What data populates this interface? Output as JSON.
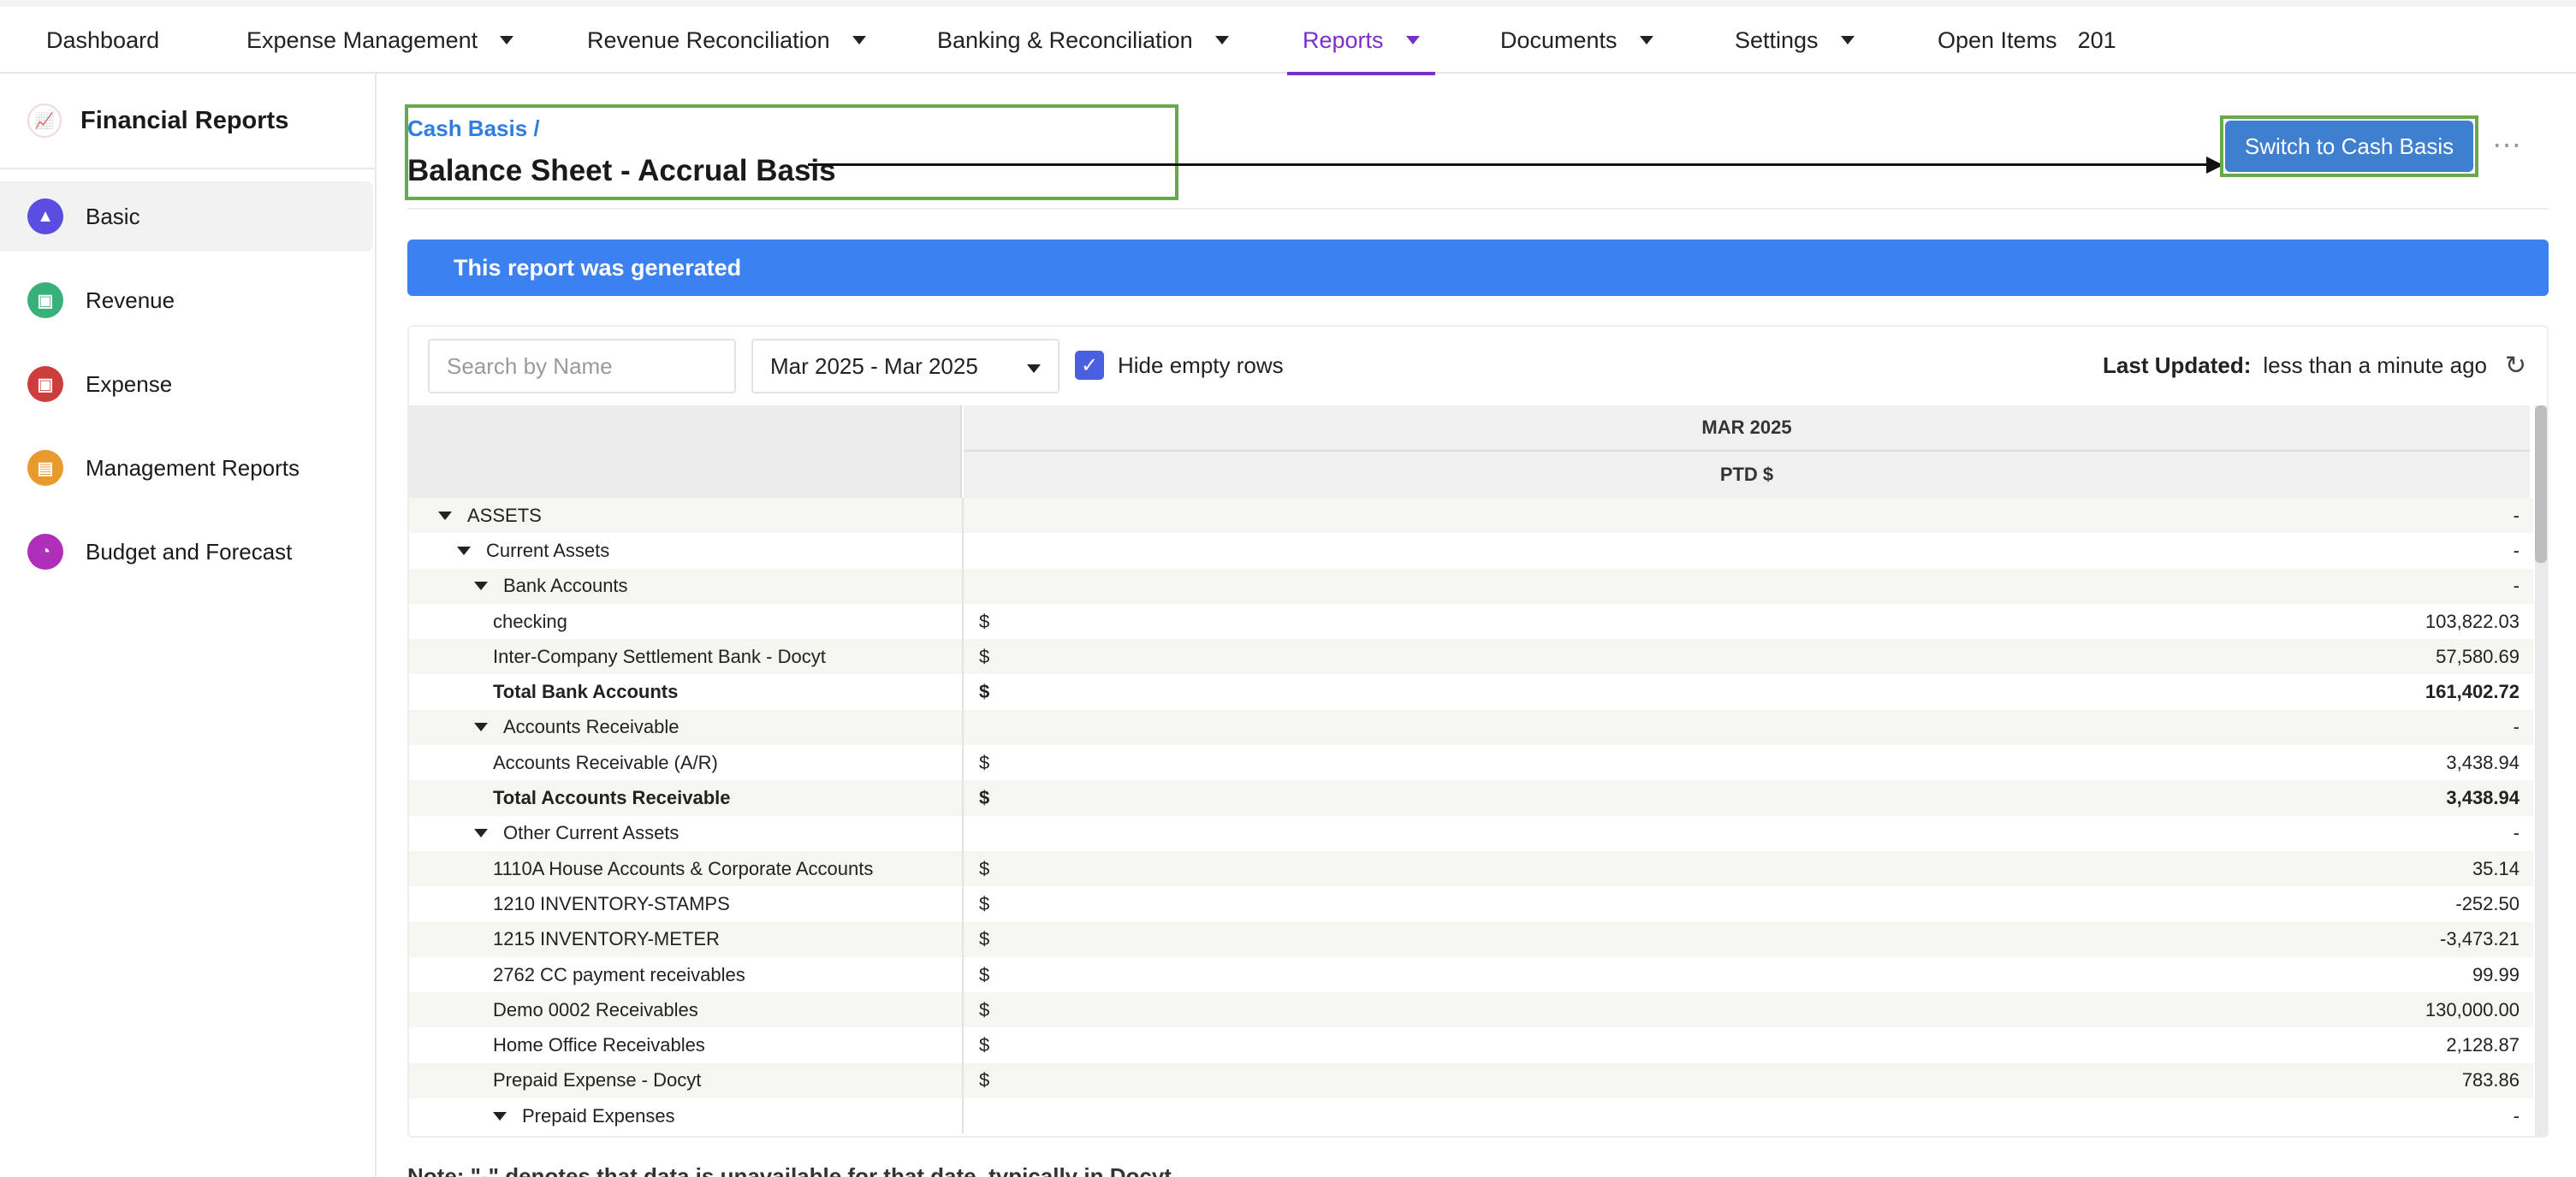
{
  "nav": {
    "items": [
      {
        "label": "Dashboard",
        "dropdown": false
      },
      {
        "label": "Expense Management",
        "dropdown": true
      },
      {
        "label": "Revenue Reconciliation",
        "dropdown": true
      },
      {
        "label": "Banking & Reconciliation",
        "dropdown": true
      },
      {
        "label": "Reports",
        "dropdown": true,
        "active": true
      },
      {
        "label": "Documents",
        "dropdown": true
      },
      {
        "label": "Settings",
        "dropdown": true
      }
    ],
    "open_items_label": "Open Items",
    "open_items_count": "201",
    "active_color": "#7a2fc9"
  },
  "sidebar": {
    "title": "Financial Reports",
    "logo_icon": "chart-icon",
    "items": [
      {
        "label": "Basic",
        "icon": "bar-chart-icon",
        "color": "#5b4de0",
        "active": true
      },
      {
        "label": "Revenue",
        "icon": "receipt-icon",
        "color": "#38b07a"
      },
      {
        "label": "Expense",
        "icon": "expense-icon",
        "color": "#cc3e3e"
      },
      {
        "label": "Management Reports",
        "icon": "document-icon",
        "color": "#e89a2c"
      },
      {
        "label": "Budget and Forecast",
        "icon": "pie-chart-icon",
        "color": "#b02fb8"
      }
    ]
  },
  "header": {
    "breadcrumb": "Cash Basis",
    "breadcrumb_sep": "/",
    "title": "Balance Sheet - Accrual Basis",
    "switch_button": "Switch to Cash Basis",
    "more_icon": "more-horizontal-icon"
  },
  "banner": {
    "text": "This report was generated",
    "color": "#3b82f0"
  },
  "toolbar": {
    "search_placeholder": "Search by Name",
    "date_range": "Mar 2025 - Mar 2025",
    "hide_empty_label": "Hide empty rows",
    "hide_empty_checked": true,
    "last_updated_label": "Last Updated:",
    "last_updated_value": "less than a minute ago",
    "refresh_icon": "refresh-icon"
  },
  "table": {
    "period_header": "MAR 2025",
    "column_header": "PTD $",
    "rows": [
      {
        "name": "ASSETS",
        "level": 0,
        "expand": true,
        "currency": "",
        "value": "-",
        "total": false
      },
      {
        "name": "Current Assets",
        "level": 1,
        "expand": true,
        "currency": "",
        "value": "-",
        "total": false
      },
      {
        "name": "Bank Accounts",
        "level": 2,
        "expand": true,
        "currency": "",
        "value": "-",
        "total": false
      },
      {
        "name": "checking",
        "level": 3,
        "expand": false,
        "currency": "$",
        "value": "103,822.03",
        "total": false
      },
      {
        "name": "Inter-Company Settlement Bank - Docyt",
        "level": 3,
        "expand": false,
        "currency": "$",
        "value": "57,580.69",
        "total": false
      },
      {
        "name": "Total Bank Accounts",
        "level": 3,
        "expand": false,
        "currency": "$",
        "value": "161,402.72",
        "total": true
      },
      {
        "name": "Accounts Receivable",
        "level": 2,
        "expand": true,
        "currency": "",
        "value": "-",
        "total": false
      },
      {
        "name": "Accounts Receivable (A/R)",
        "level": 3,
        "expand": false,
        "currency": "$",
        "value": "3,438.94",
        "total": false
      },
      {
        "name": "Total Accounts Receivable",
        "level": 3,
        "expand": false,
        "currency": "$",
        "value": "3,438.94",
        "total": true
      },
      {
        "name": "Other Current Assets",
        "level": 2,
        "expand": true,
        "currency": "",
        "value": "-",
        "total": false
      },
      {
        "name": "1110A House Accounts & Corporate Accounts",
        "level": 3,
        "expand": false,
        "currency": "$",
        "value": "35.14",
        "total": false
      },
      {
        "name": "1210 INVENTORY-STAMPS",
        "level": 3,
        "expand": false,
        "currency": "$",
        "value": "-252.50",
        "total": false
      },
      {
        "name": "1215 INVENTORY-METER",
        "level": 3,
        "expand": false,
        "currency": "$",
        "value": "-3,473.21",
        "total": false
      },
      {
        "name": "2762 CC payment receivables",
        "level": 3,
        "expand": false,
        "currency": "$",
        "value": "99.99",
        "total": false
      },
      {
        "name": "Demo 0002 Receivables",
        "level": 3,
        "expand": false,
        "currency": "$",
        "value": "130,000.00",
        "total": false
      },
      {
        "name": "Home Office Receivables",
        "level": 3,
        "expand": false,
        "currency": "$",
        "value": "2,128.87",
        "total": false
      },
      {
        "name": "Prepaid Expense - Docyt",
        "level": 3,
        "expand": false,
        "currency": "$",
        "value": "783.86",
        "total": false
      },
      {
        "name": "Prepaid Expenses",
        "level": 4,
        "expand": true,
        "currency": "",
        "value": "-",
        "total": false
      }
    ]
  },
  "note": "Note: \"-\" denotes that data is unavailable for that date, typically in Docyt."
}
